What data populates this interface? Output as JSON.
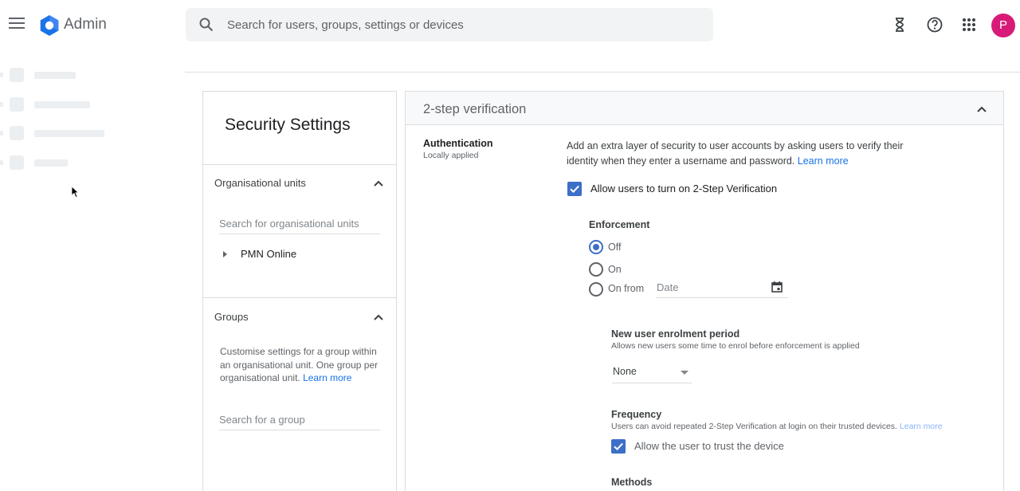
{
  "header": {
    "app_title": "Admin",
    "search_placeholder": "Search for users, groups, settings or devices",
    "avatar_initial": "P",
    "icons": [
      "menu-icon",
      "admin-logo",
      "search-icon",
      "hourglass-icon",
      "help-icon",
      "apps-grid-icon"
    ]
  },
  "left_panel": {
    "title": "Security Settings",
    "org_units": {
      "heading": "Organisational units",
      "search_placeholder": "Search for organisational units",
      "tree_item": "PMN Online"
    },
    "groups": {
      "heading": "Groups",
      "description": "Customise settings for a group within an organisational unit. One group per organisational unit.",
      "learn_more": "Learn more",
      "search_placeholder": "Search for a group"
    }
  },
  "right_panel": {
    "section_title": "2-step verification",
    "auth_title": "Authentication",
    "auth_subtitle": "Locally applied",
    "intro_text": "Add an extra layer of security to user accounts by asking users to verify their identity when they enter a username and password.",
    "intro_link": "Learn more",
    "allow_checkbox_label": "Allow users to turn on 2-Step Verification",
    "allow_checked": true,
    "enforcement": {
      "title": "Enforcement",
      "options": [
        "Off",
        "On",
        "On from"
      ],
      "selected": "Off",
      "date_placeholder": "Date"
    },
    "enrolment": {
      "title": "New user enrolment period",
      "subtitle": "Allows new users some time to enrol before enforcement is applied",
      "value": "None"
    },
    "frequency": {
      "title": "Frequency",
      "subtitle": "Users can avoid repeated 2-Step Verification at login on their trusted devices.",
      "learn_more": "Learn more",
      "trust_label": "Allow the user to trust the device",
      "trust_checked": true
    },
    "methods_title": "Methods"
  },
  "colors": {
    "accent": "#3c6fc8",
    "link": "#1a73e8",
    "avatar": "#d81b78"
  }
}
